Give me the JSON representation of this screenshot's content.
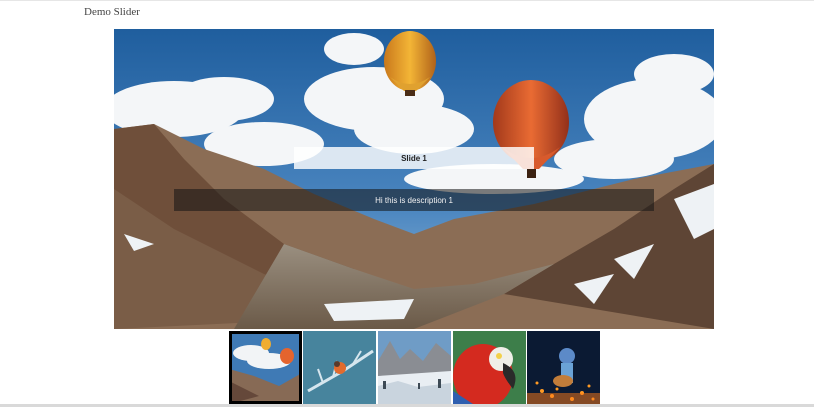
{
  "page": {
    "title": "Demo Slider"
  },
  "slider": {
    "current_slide": {
      "title": "Slide 1",
      "description": "Hi this is description 1",
      "image": "hot-air-balloons-mountains"
    },
    "thumbnails": [
      {
        "image": "hot-air-balloons-mountains",
        "active": true
      },
      {
        "image": "bird-on-frosted-branch",
        "active": false
      },
      {
        "image": "snowy-valley-cliffs",
        "active": false
      },
      {
        "image": "red-macaw-parrot",
        "active": false
      },
      {
        "image": "guitarist-with-sparks",
        "active": false
      }
    ]
  }
}
